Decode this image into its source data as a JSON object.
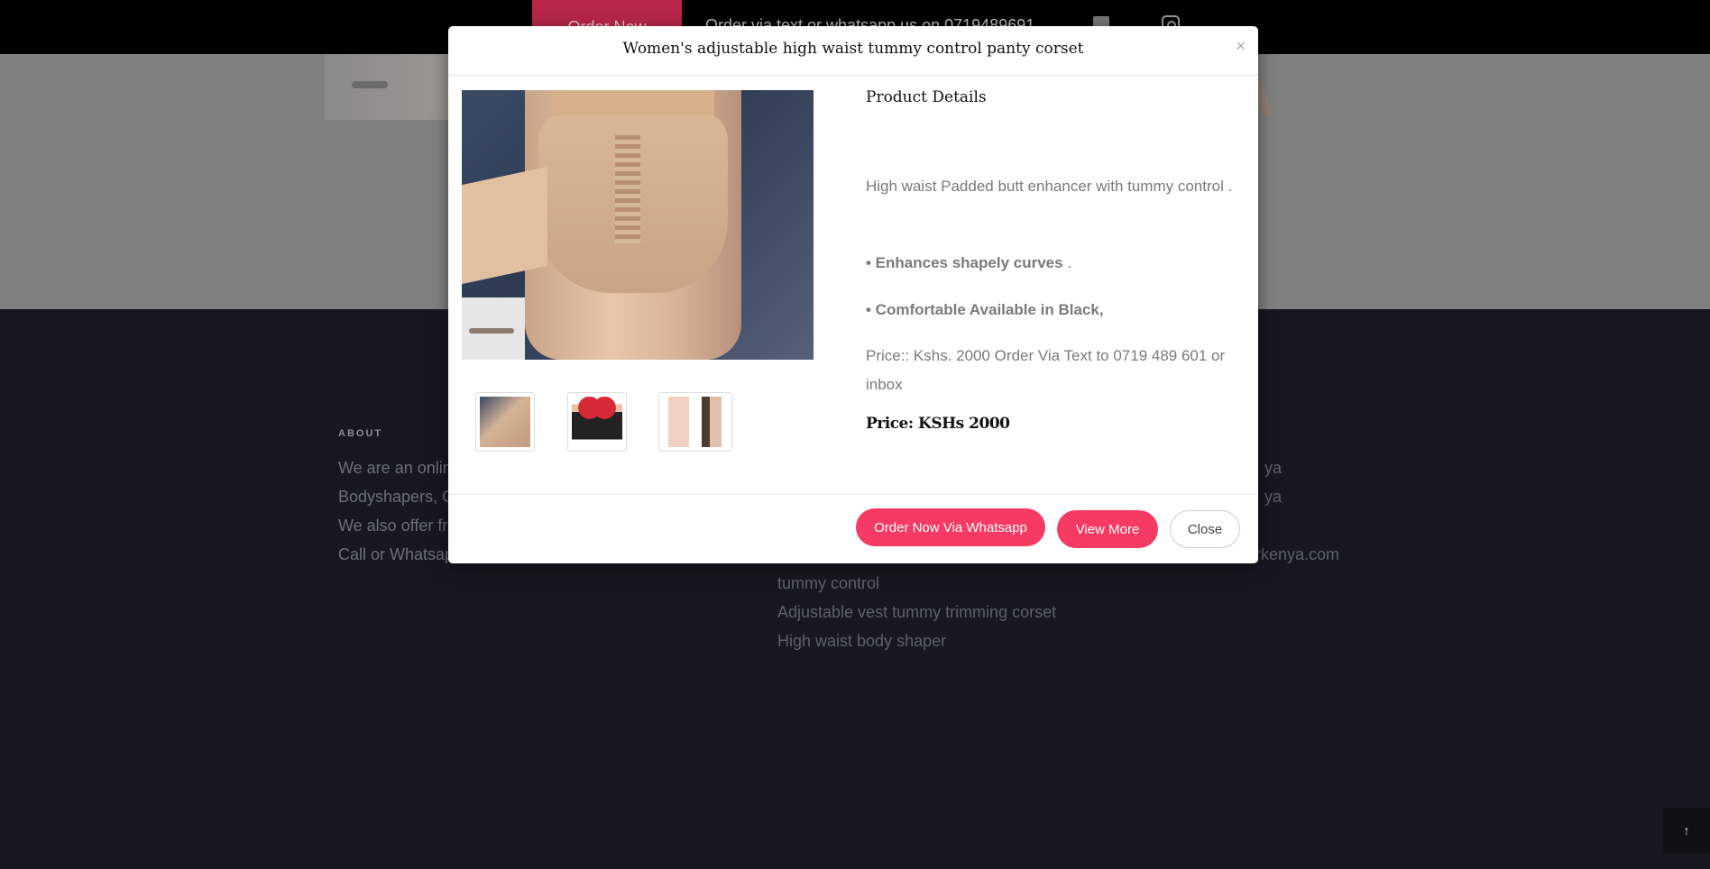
{
  "topbar": {
    "order_now": "Order Now",
    "order_text": "Order via text or whatsapp us on 0719489691"
  },
  "footer": {
    "about_heading": "ABOUT",
    "about_lines": [
      "We are an onlin",
      "Bodyshapers, C",
      "We also offer fr",
      "Call or Whatsap"
    ],
    "link_lines": [
      "tummy control",
      "Adjustable vest tummy trimming corset",
      "High waist body shaper"
    ],
    "right_lines": [
      "ya",
      "ya",
      "rkenya.com"
    ],
    "back_to_top": "↑"
  },
  "modal": {
    "title": "Women's adjustable high waist tummy control panty corset",
    "close_x": "×",
    "details_title": "Product Details",
    "description": "High waist Padded butt enhancer with tummy control .",
    "bullet_1": "• Enhances shapely curves",
    "bullet_1_suffix": " .",
    "bullet_2": "• Comfortable Available in Black,",
    "price_text": "Price:: Kshs. 2000 Order Via Text to 0719 489 601 or inbox",
    "price_label": "Price: KSHs 2000",
    "buttons": {
      "whatsapp": "Order Now Via Whatsapp",
      "view_more": "View More",
      "close": "Close"
    }
  },
  "colors": {
    "accent": "#f63a63",
    "footer_bg": "#15181f"
  }
}
